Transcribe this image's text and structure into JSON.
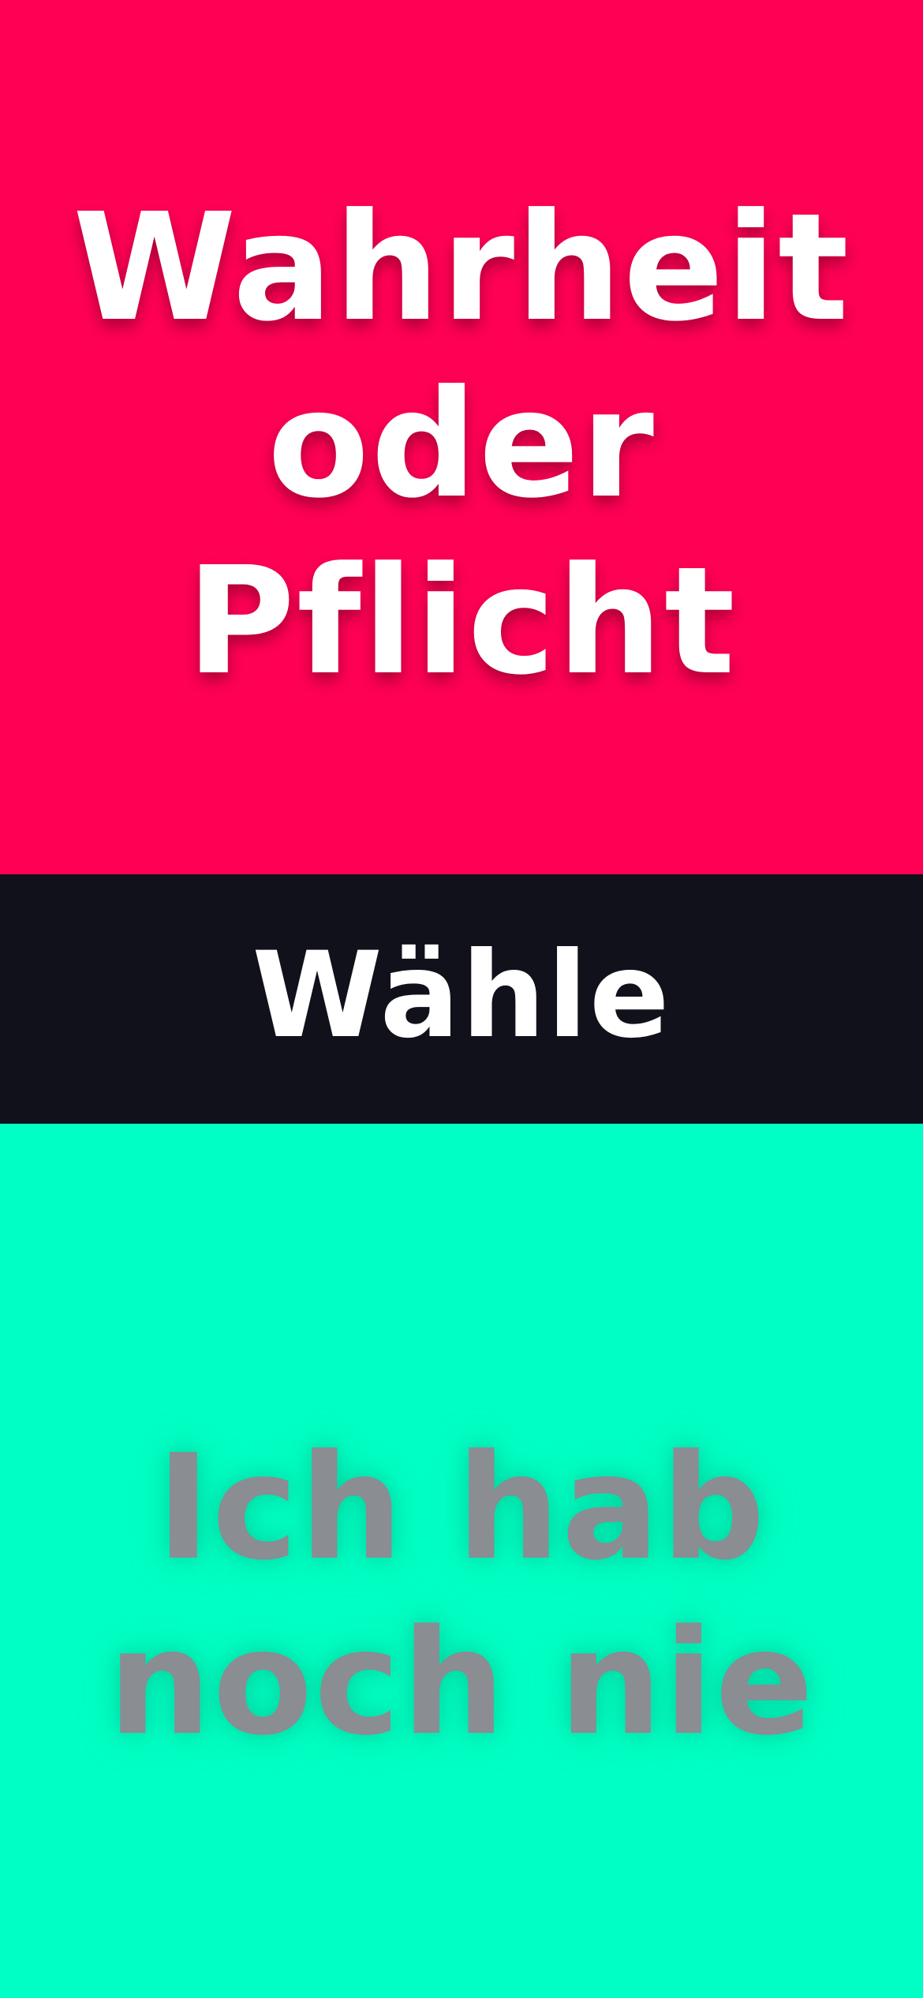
{
  "modes": {
    "truth_or_dare": {
      "title": "Wahrheit\noder\nPflicht",
      "background": "#ff0055",
      "text_color": "#ffffff"
    },
    "never_have_i_ever": {
      "title": "Ich hab\nnoch nie",
      "background": "#00ffc4",
      "text_color": "#8a8d92"
    }
  },
  "divider": {
    "label": "Wähle",
    "background": "#10111b",
    "text_color": "#ffffff"
  }
}
